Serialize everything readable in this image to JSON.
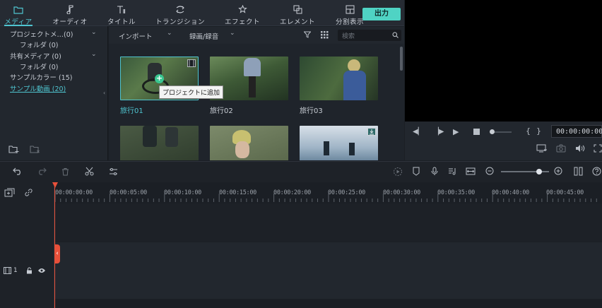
{
  "tabs": [
    {
      "label": "メディア",
      "icon": "folder-icon"
    },
    {
      "label": "オーディオ",
      "icon": "music-note-icon"
    },
    {
      "label": "タイトル",
      "icon": "title-icon"
    },
    {
      "label": "トランジション",
      "icon": "transition-icon"
    },
    {
      "label": "エフェクト",
      "icon": "effects-icon"
    },
    {
      "label": "エレメント",
      "icon": "elements-icon"
    },
    {
      "label": "分割表示",
      "icon": "split-screen-icon"
    }
  ],
  "export_label": "出力",
  "library": [
    {
      "label": "プロジェクトメ…(0)"
    },
    {
      "label": "フォルダ (0)"
    },
    {
      "label": "共有メディア (0)"
    },
    {
      "label": "フォルダ (0)"
    },
    {
      "label": "サンプルカラー (15)"
    },
    {
      "label": "サンプル動画 (20)"
    }
  ],
  "media_toolbar": {
    "import_label": "インポート",
    "record_label": "録画/録音",
    "search_placeholder": "検索"
  },
  "media": [
    {
      "label": "旅行01"
    },
    {
      "label": "旅行02"
    },
    {
      "label": "旅行03"
    }
  ],
  "tooltip": "プロジェクトに追加",
  "timecode": "00:00:00:00",
  "ruler_ticks": [
    "00:00:00:00",
    "00:00:05:00",
    "00:00:10:00",
    "00:00:15:00",
    "00:00:20:00",
    "00:00:25:00",
    "00:00:30:00",
    "00:00:35:00",
    "00:00:40:00",
    "00:00:45:00"
  ],
  "track_label": "1",
  "zoom_fraction": 0.8,
  "colors": {
    "accent": "#4fc4cf",
    "export": "#4fd3c4",
    "playhead": "#e8503a"
  }
}
